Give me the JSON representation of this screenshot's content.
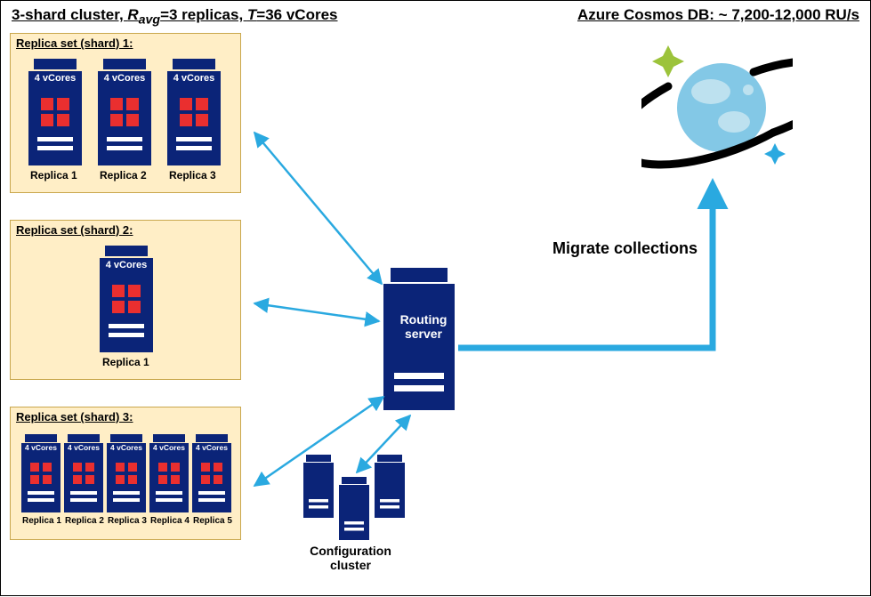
{
  "heading_left_prefix": "3-shard cluster, ",
  "heading_left_r": "R",
  "heading_left_avg": "avg",
  "heading_left_mid": "=3 replicas, ",
  "heading_left_t": "T",
  "heading_left_end": "=36 vCores",
  "heading_right": "Azure Cosmos DB: ~ 7,200-12,000 RU/s",
  "shards": [
    {
      "title": "Replica set (shard) 1:",
      "replicas": [
        {
          "cores": "4 vCores",
          "caption": "Replica 1"
        },
        {
          "cores": "4 vCores",
          "caption": "Replica 2"
        },
        {
          "cores": "4 vCores",
          "caption": "Replica 3"
        }
      ]
    },
    {
      "title": "Replica set (shard) 2:",
      "replicas": [
        {
          "cores": "4 vCores",
          "caption": "Replica 1"
        }
      ]
    },
    {
      "title": "Replica set (shard) 3:",
      "replicas": [
        {
          "cores": "4 vCores",
          "caption": "Replica 1"
        },
        {
          "cores": "4 vCores",
          "caption": "Replica 2"
        },
        {
          "cores": "4 vCores",
          "caption": "Replica 3"
        },
        {
          "cores": "4 vCores",
          "caption": "Replica 4"
        },
        {
          "cores": "4 vCores",
          "caption": "Replica 5"
        }
      ]
    }
  ],
  "routing_label": "Routing server",
  "config_label": "Configuration cluster",
  "migrate_label": "Migrate collections",
  "colors": {
    "server_blue": "#0b2478",
    "accent_red": "#ea2f2f",
    "arrow_blue": "#2aa9e0",
    "shard_bg": "#ffeec6",
    "shard_border": "#c9a74d",
    "cosmos_planet": "#83c8e6",
    "cosmos_cloud": "#bde1ef",
    "cosmos_ring": "#000000",
    "sparkle": "#9cc33b"
  }
}
